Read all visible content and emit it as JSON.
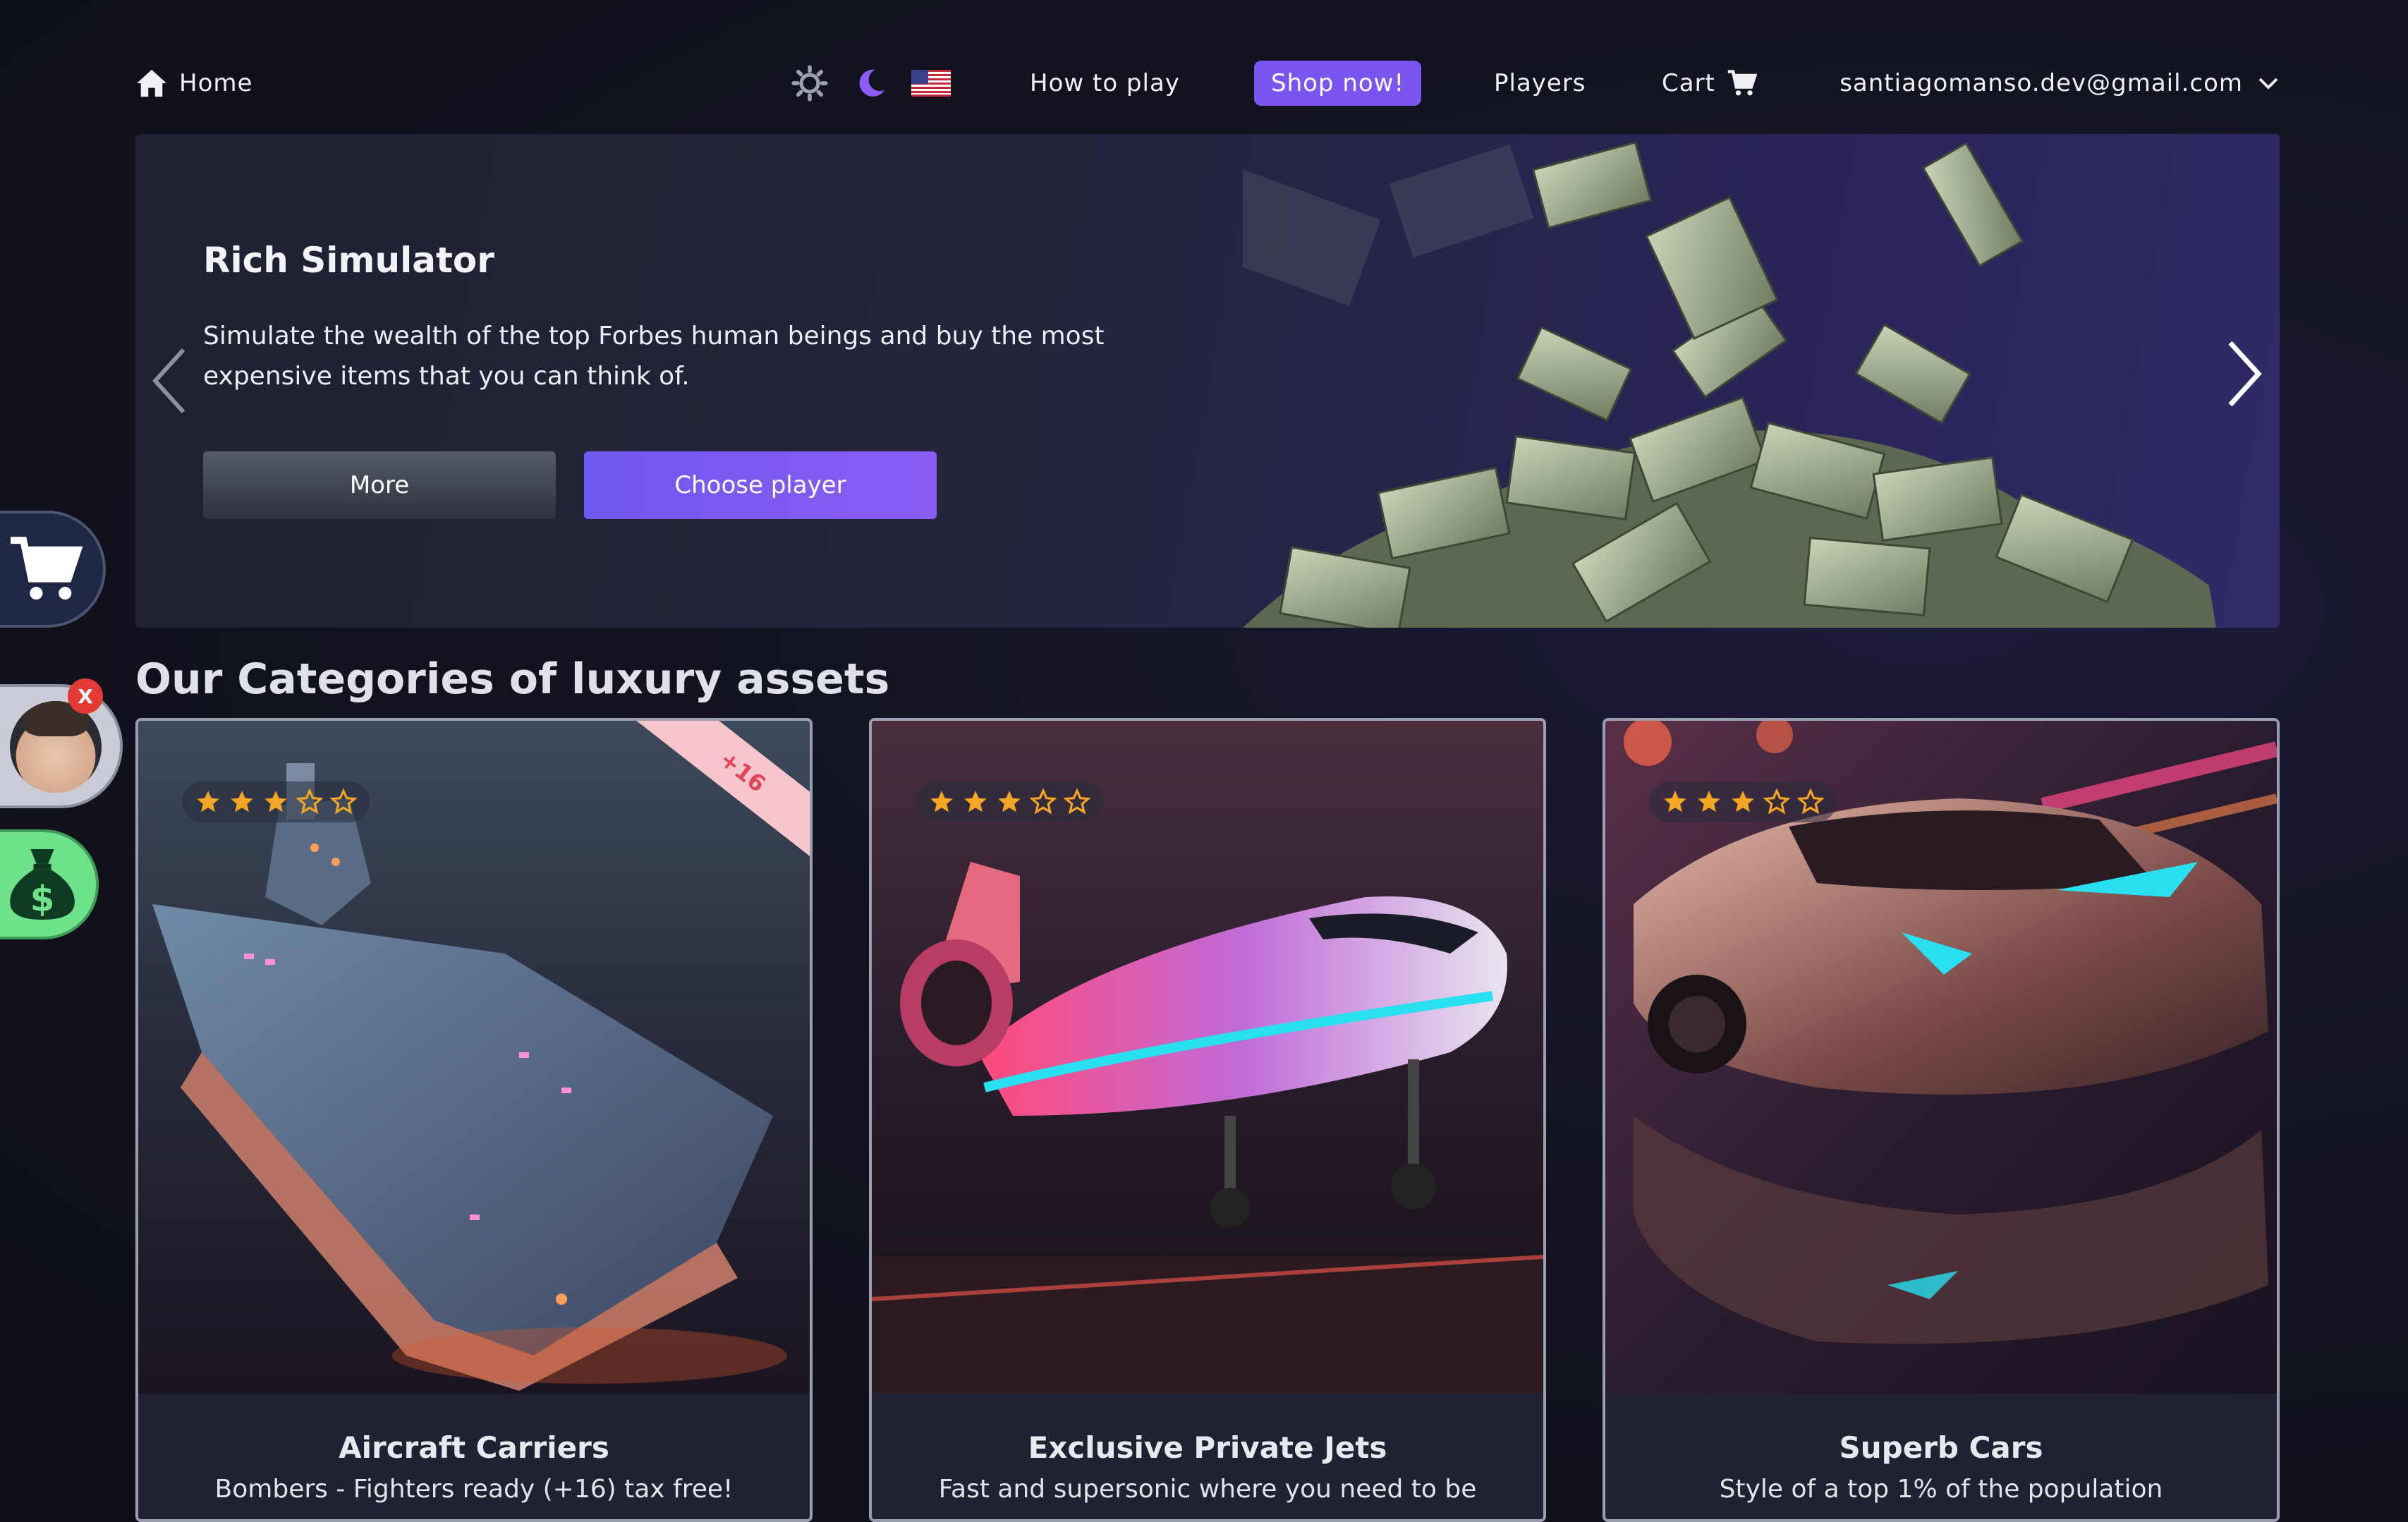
{
  "nav": {
    "home_label": "Home",
    "how_to_play": "How to play",
    "shop_now": "Shop now!",
    "players": "Players",
    "cart": "Cart",
    "account_email": "santiagomanso.dev@gmail.com",
    "icons": [
      "home-icon",
      "sun-icon",
      "moon-icon",
      "us-flag-icon",
      "cart-icon",
      "chevron-down-icon"
    ],
    "colors": {
      "accent": "#7b55f2",
      "moon": "#8b5cf6"
    }
  },
  "hero": {
    "title": "Rich Simulator",
    "description": "Simulate the wealth of the top Forbes human beings and buy the most expensive items that you can think of.",
    "more_button": "More",
    "choose_player_button": "Choose player"
  },
  "side": {
    "close_label": "X",
    "icons": [
      "cart-icon",
      "avatar",
      "money-bag-icon"
    ]
  },
  "categories": {
    "title": "Our Categories of luxury assets",
    "items": [
      {
        "name": "Aircraft Carriers",
        "subtitle": "Bombers - Fighters ready (+16) tax free!",
        "rating": 3,
        "max_rating": 5,
        "badge": "+16"
      },
      {
        "name": "Exclusive Private Jets",
        "subtitle": "Fast and supersonic where you need to be",
        "rating": 3,
        "max_rating": 5
      },
      {
        "name": "Superb Cars",
        "subtitle": "Style of a top 1% of the population",
        "rating": 3,
        "max_rating": 5
      }
    ]
  }
}
